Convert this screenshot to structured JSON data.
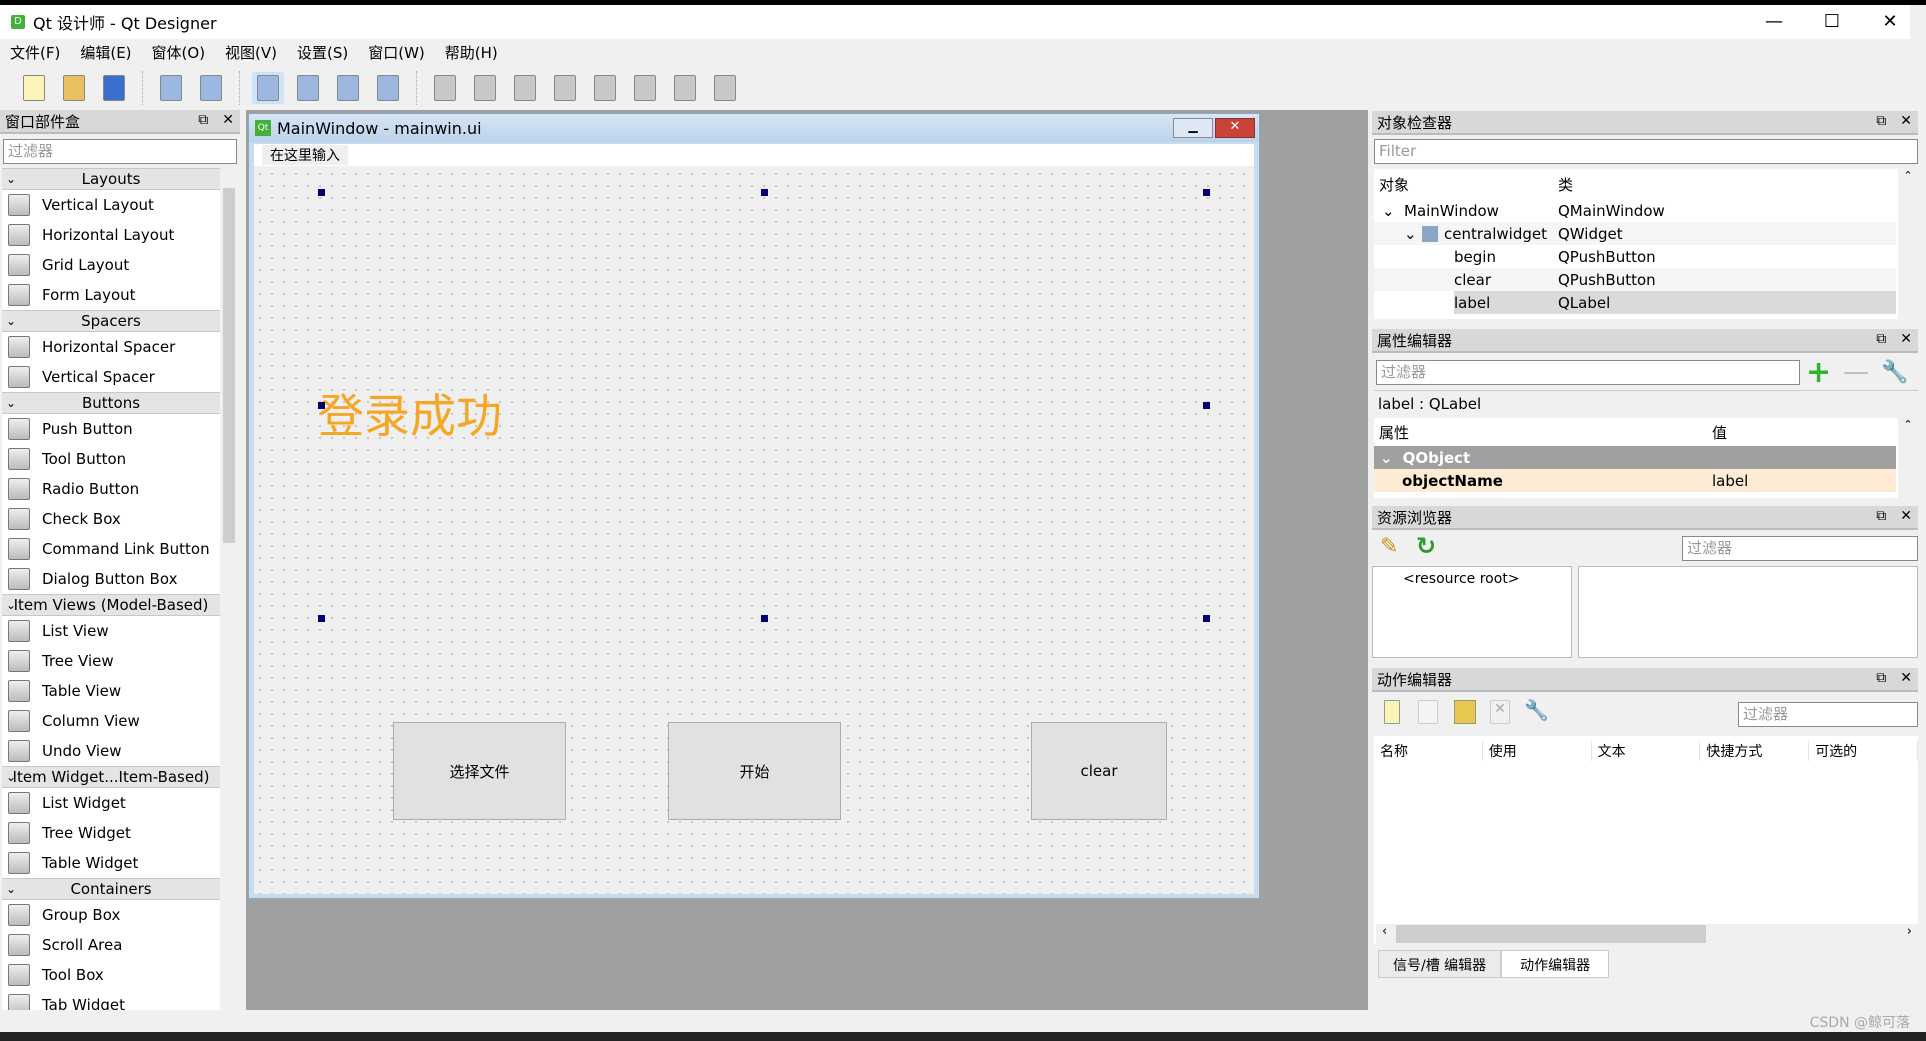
{
  "window": {
    "title": "Qt 设计师 - Qt Designer",
    "app_icon": "D",
    "controls": [
      "—",
      "☐",
      "✕"
    ]
  },
  "menubar": [
    "文件(F)",
    "编辑(E)",
    "窗体(O)",
    "视图(V)",
    "设置(S)",
    "窗口(W)",
    "帮助(H)"
  ],
  "toolbar": [
    "new",
    "open",
    "save",
    "bring-to-front",
    "send-to-back",
    "edit-widgets",
    "edit-signals-slots",
    "edit-buddies",
    "edit-tab-order",
    "layout-horizontal",
    "layout-vertical",
    "layout-h-splitter",
    "layout-v-splitter",
    "layout-grid",
    "layout-form",
    "break-layout",
    "adjust-size"
  ],
  "widget_box": {
    "title": "窗口部件盒",
    "filter_placeholder": "过滤器",
    "items": [
      {
        "cat": "Layouts"
      },
      {
        "label": "Vertical Layout"
      },
      {
        "label": "Horizontal Layout"
      },
      {
        "label": "Grid Layout"
      },
      {
        "label": "Form Layout"
      },
      {
        "cat": "Spacers"
      },
      {
        "label": "Horizontal Spacer"
      },
      {
        "label": "Vertical Spacer"
      },
      {
        "cat": "Buttons"
      },
      {
        "label": "Push Button"
      },
      {
        "label": "Tool Button"
      },
      {
        "label": "Radio Button"
      },
      {
        "label": "Check Box"
      },
      {
        "label": "Command Link Button"
      },
      {
        "label": "Dialog Button Box"
      },
      {
        "cat": "Item Views (Model-Based)"
      },
      {
        "label": "List View"
      },
      {
        "label": "Tree View"
      },
      {
        "label": "Table View"
      },
      {
        "label": "Column View"
      },
      {
        "label": "Undo View"
      },
      {
        "cat": "Item Widget...Item-Based)"
      },
      {
        "label": "List Widget"
      },
      {
        "label": "Tree Widget"
      },
      {
        "label": "Table Widget"
      },
      {
        "cat": "Containers"
      },
      {
        "label": "Group Box"
      },
      {
        "label": "Scroll Area"
      },
      {
        "label": "Tool Box"
      },
      {
        "label": "Tab Widget"
      }
    ]
  },
  "form": {
    "title": "MainWindow - mainwin.ui",
    "menu_placeholder": "在这里输入",
    "label_text": "登录成功",
    "label_color": "#f5a623",
    "buttons": [
      "选择文件",
      "开始",
      "clear"
    ]
  },
  "object_inspector": {
    "title": "对象检查器",
    "filter_placeholder": "Filter",
    "col_object": "对象",
    "col_class": "类",
    "rows": [
      {
        "obj": "MainWindow",
        "cls": "QMainWindow"
      },
      {
        "obj": "centralwidget",
        "cls": "QWidget"
      },
      {
        "obj": "begin",
        "cls": "QPushButton"
      },
      {
        "obj": "clear",
        "cls": "QPushButton"
      },
      {
        "obj": "label",
        "cls": "QLabel"
      }
    ]
  },
  "property_editor": {
    "title": "属性编辑器",
    "filter_placeholder": "过滤器",
    "selected": "label : QLabel",
    "col_prop": "属性",
    "col_value": "值",
    "group": "QObject",
    "prop_name": "objectName",
    "prop_value": "label"
  },
  "resource_browser": {
    "title": "资源浏览器",
    "filter_placeholder": "过滤器",
    "root": "<resource root>"
  },
  "action_editor": {
    "title": "动作编辑器",
    "filter_placeholder": "过滤器",
    "columns": [
      "名称",
      "使用",
      "文本",
      "快捷方式",
      "可选的"
    ]
  },
  "bottom_tabs": [
    "信号/槽 编辑器",
    "动作编辑器"
  ],
  "watermark": "CSDN @鲸可落"
}
